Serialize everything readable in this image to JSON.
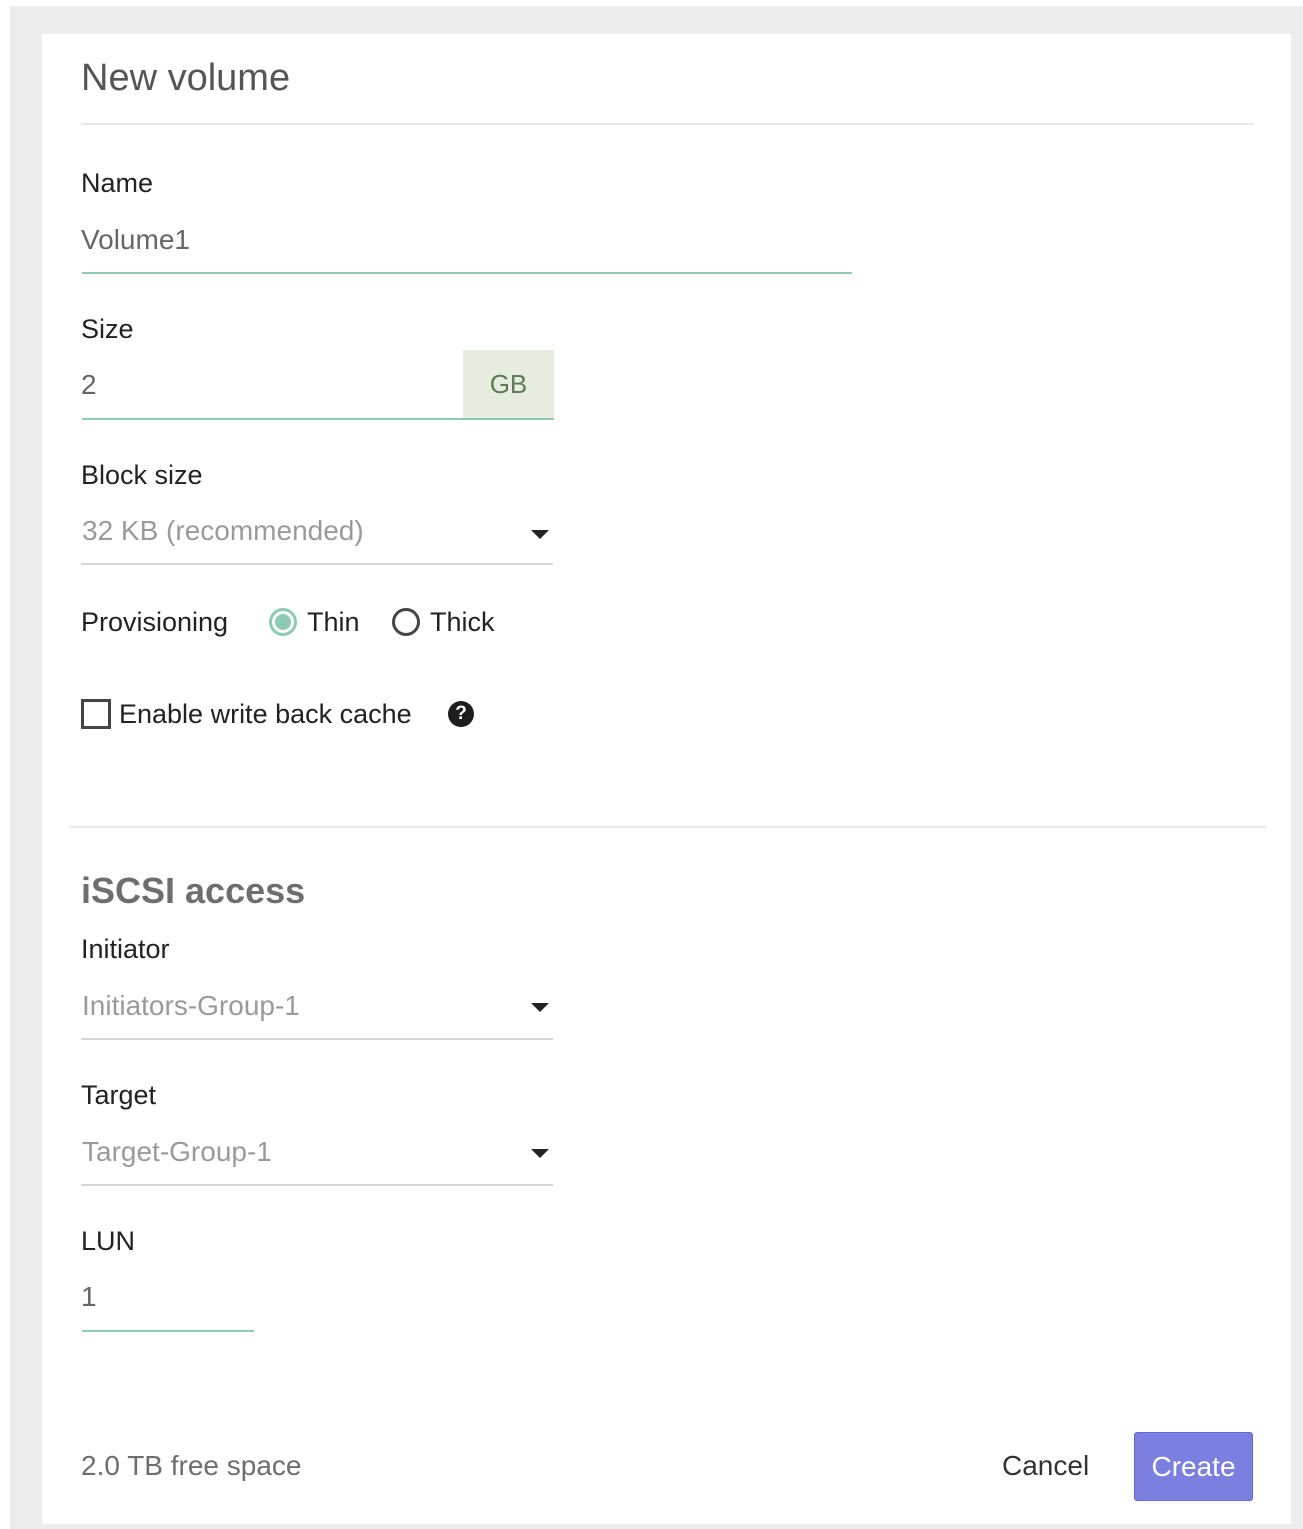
{
  "dialog": {
    "title": "New volume",
    "free_space": "2.0 TB free space",
    "cancel_label": "Cancel",
    "create_label": "Create"
  },
  "volume": {
    "name_label": "Name",
    "name_value": "Volume1",
    "size_label": "Size",
    "size_value": "2",
    "size_unit": "GB",
    "block_size_label": "Block size",
    "block_size_value": "32 KB (recommended)",
    "provisioning_label": "Provisioning",
    "provisioning_options": [
      {
        "label": "Thin",
        "selected": true
      },
      {
        "label": "Thick",
        "selected": false
      }
    ],
    "write_back_cache_label": "Enable write back cache",
    "write_back_cache_checked": false
  },
  "iscsi": {
    "section_title": "iSCSI access",
    "initiator_label": "Initiator",
    "initiator_value": "Initiators-Group-1",
    "target_label": "Target",
    "target_value": "Target-Group-1",
    "lun_label": "LUN",
    "lun_value": "1"
  },
  "colors": {
    "accent_green": "#8ecab2",
    "primary_button": "#7b7fe0",
    "unit_addon_bg": "#e6eddf"
  },
  "icons": {
    "help": "question-circle-icon",
    "caret": "caret-down-icon"
  }
}
